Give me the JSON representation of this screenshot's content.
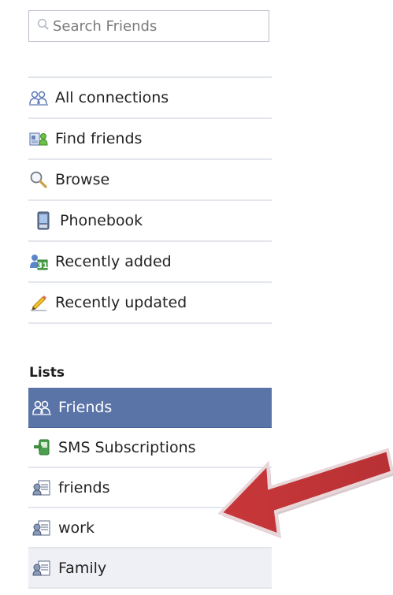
{
  "search": {
    "placeholder": "Search Friends"
  },
  "nav": {
    "items": [
      {
        "label": "All connections",
        "icon": "people-icon"
      },
      {
        "label": "Find friends",
        "icon": "find-friends-icon"
      },
      {
        "label": "Browse",
        "icon": "magnifier-icon"
      },
      {
        "label": "Phonebook",
        "icon": "phone-icon"
      },
      {
        "label": "Recently added",
        "icon": "recently-added-icon"
      },
      {
        "label": "Recently updated",
        "icon": "pencil-icon"
      }
    ]
  },
  "lists": {
    "heading": "Lists",
    "items": [
      {
        "label": "Friends",
        "icon": "people-icon",
        "selected": true
      },
      {
        "label": "SMS Subscriptions",
        "icon": "sms-icon"
      },
      {
        "label": "friends",
        "icon": "list-icon"
      },
      {
        "label": "work",
        "icon": "list-icon"
      },
      {
        "label": "Family",
        "icon": "list-icon"
      }
    ]
  },
  "colors": {
    "selected_bg": "#5b74a8",
    "arrow": "#c0393b",
    "divider": "#e3e6ec"
  }
}
